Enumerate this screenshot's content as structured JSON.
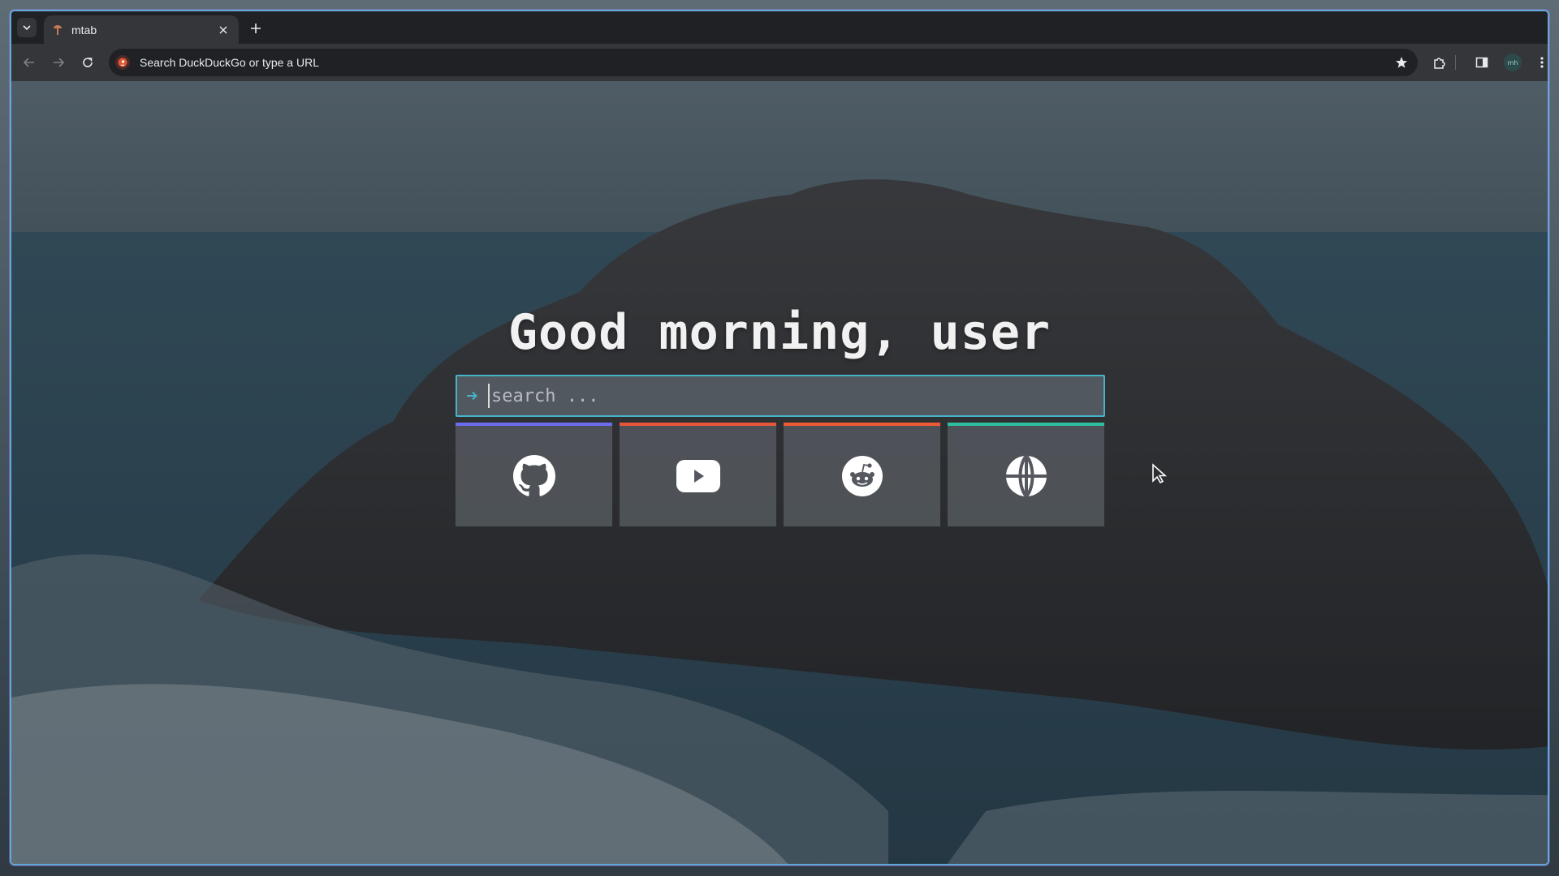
{
  "browser": {
    "tab": {
      "title": "mtab",
      "favicon": "mtab-icon"
    },
    "omnibox": {
      "text": "Search DuckDuckGo or type a URL",
      "engine_icon": "duckduckgo-icon"
    },
    "avatar_text": "mh",
    "toolbar_icons": [
      "back-icon",
      "forward-icon",
      "reload-icon",
      "bookmark-star-icon",
      "extensions-icon",
      "side-panel-icon",
      "avatar",
      "kebab-menu-icon"
    ]
  },
  "page": {
    "greeting": "Good morning, user",
    "search": {
      "placeholder": "search ...",
      "value": "",
      "accent": "#45b4c8"
    },
    "links": [
      {
        "name": "github",
        "icon": "github-icon",
        "accent": "#6c6cf0"
      },
      {
        "name": "youtube",
        "icon": "youtube-icon",
        "accent": "#e8573a"
      },
      {
        "name": "reddit",
        "icon": "reddit-icon",
        "accent": "#ef5a35"
      },
      {
        "name": "website",
        "icon": "globe-icon",
        "accent": "#2fc0a2"
      }
    ]
  }
}
